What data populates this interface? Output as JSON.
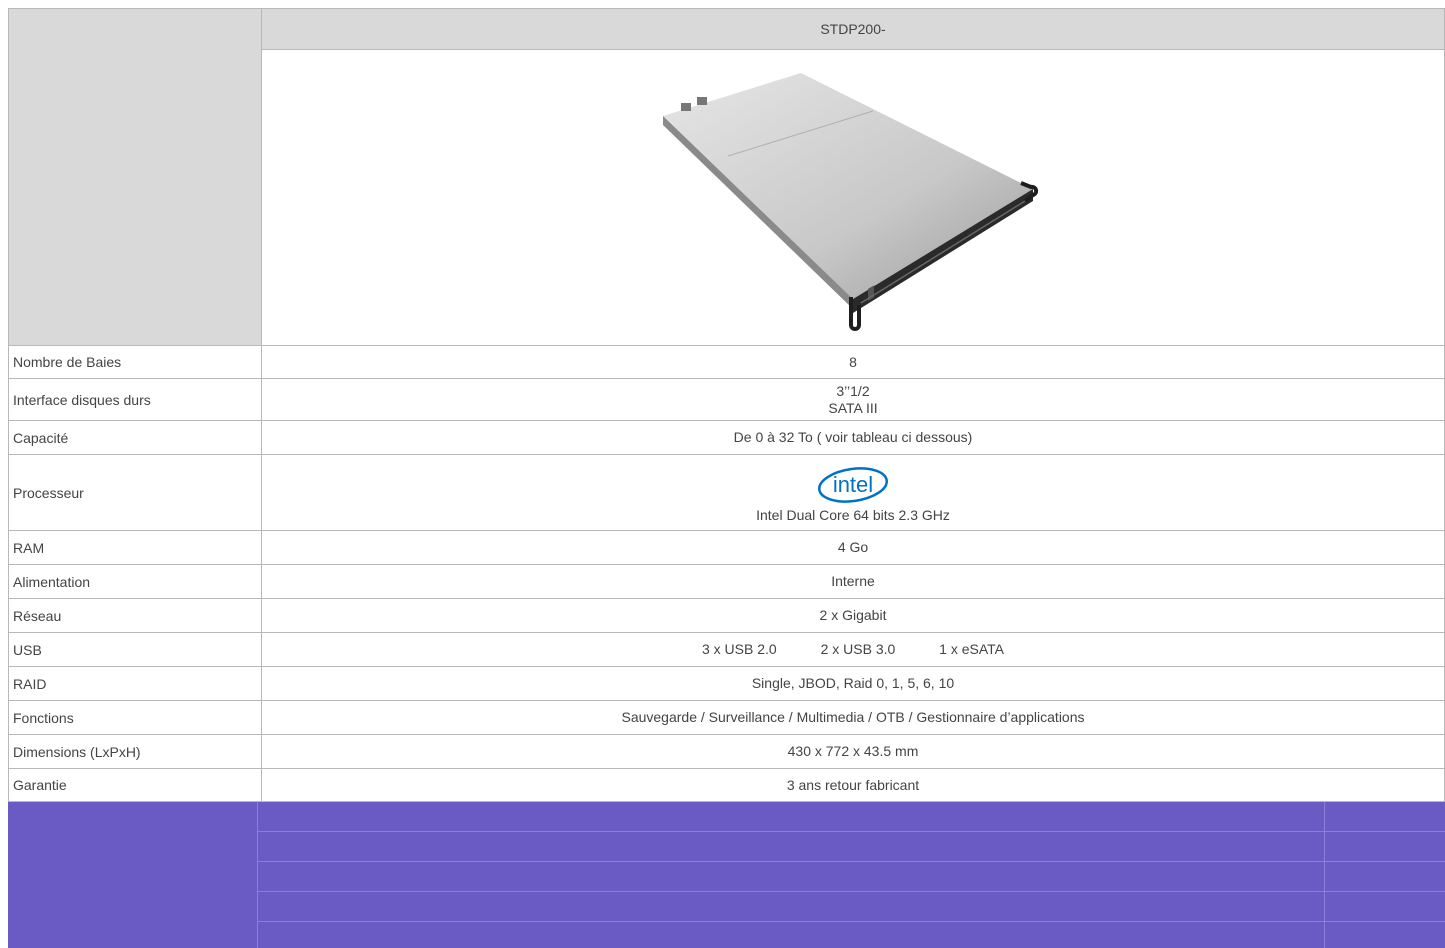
{
  "product": {
    "model": "STDP200-"
  },
  "specs": {
    "bays": {
      "label": "Nombre de Baies",
      "value": "8"
    },
    "interface": {
      "label": "Interface disques durs",
      "line1": "3’’1/2",
      "line2": "SATA III"
    },
    "capacity": {
      "label": "Capacité",
      "value": "De 0 à 32 To ( voir tableau ci dessous)"
    },
    "processor": {
      "label": "Processeur",
      "logo_text": "intel",
      "value": "Intel Dual Core 64 bits 2.3 GHz"
    },
    "ram": {
      "label": "RAM",
      "value": "4 Go"
    },
    "power": {
      "label": "Alimentation",
      "value": "Interne"
    },
    "network": {
      "label": "Réseau",
      "value": "2 x Gigabit"
    },
    "usb": {
      "label": "USB",
      "items": [
        "3 x USB 2.0",
        "2 x USB 3.0",
        "1 x eSATA"
      ]
    },
    "raid": {
      "label": "RAID",
      "value": "Single, JBOD, Raid 0, 1, 5, 6, 10"
    },
    "functions": {
      "label": "Fonctions",
      "value": "Sauvegarde / Surveillance / Multimedia / OTB / Gestionnaire d’applications"
    },
    "dimensions": {
      "label": "Dimensions (LxPxH)",
      "value": "430 x 772 x 43.5 mm"
    },
    "warranty": {
      "label": "Garantie",
      "value": "3 ans retour fabricant"
    }
  },
  "colors": {
    "header_gray": "#d9d9d9",
    "capacity_table_purple": "#6a5bc4",
    "intel_blue": "#0071c5"
  }
}
